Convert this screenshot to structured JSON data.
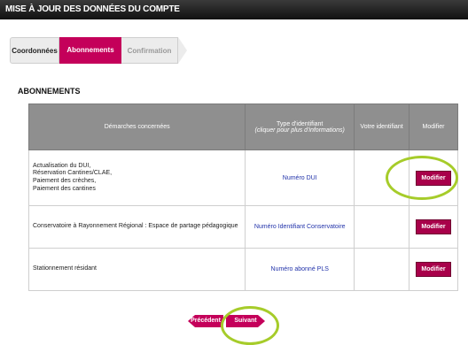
{
  "page": {
    "title": "MISE À JOUR DES DONNÉES DU COMPTE"
  },
  "steps": [
    {
      "label": "Coordonnées"
    },
    {
      "label": "Abonnements"
    },
    {
      "label": "Confirmation"
    }
  ],
  "section": {
    "title": "ABONNEMENTS"
  },
  "table": {
    "headers": {
      "col1": "Démarches concernées",
      "col2_line1": "Type d'identifiant",
      "col2_line2": "(cliquer pour plus d'informations)",
      "col3": "Votre identifiant",
      "col4": "Modifier"
    },
    "rows": [
      {
        "lines": [
          "Actualisation du DUI,",
          "Réservation Cantines/CLAE,",
          "Paiement des crèches,",
          "Paiement des cantines"
        ],
        "type": "Numéro DUI",
        "identifiant": "",
        "button": "Modifier"
      },
      {
        "lines": [
          "Conservatoire à Rayonnement Régional : Espace de partage pédagogique"
        ],
        "type": "Numéro Identifiant Conservatoire",
        "identifiant": "",
        "button": "Modifier"
      },
      {
        "lines": [
          "Stationnement résidant"
        ],
        "type": "Numéro abonné PLS",
        "identifiant": "",
        "button": "Modifier"
      }
    ]
  },
  "nav": {
    "prev": "Précédent",
    "next": "Suivant"
  },
  "colors": {
    "accent": "#c4005a",
    "highlight_ring": "#a6cc2a",
    "header_bg": "#8f8f8f"
  }
}
